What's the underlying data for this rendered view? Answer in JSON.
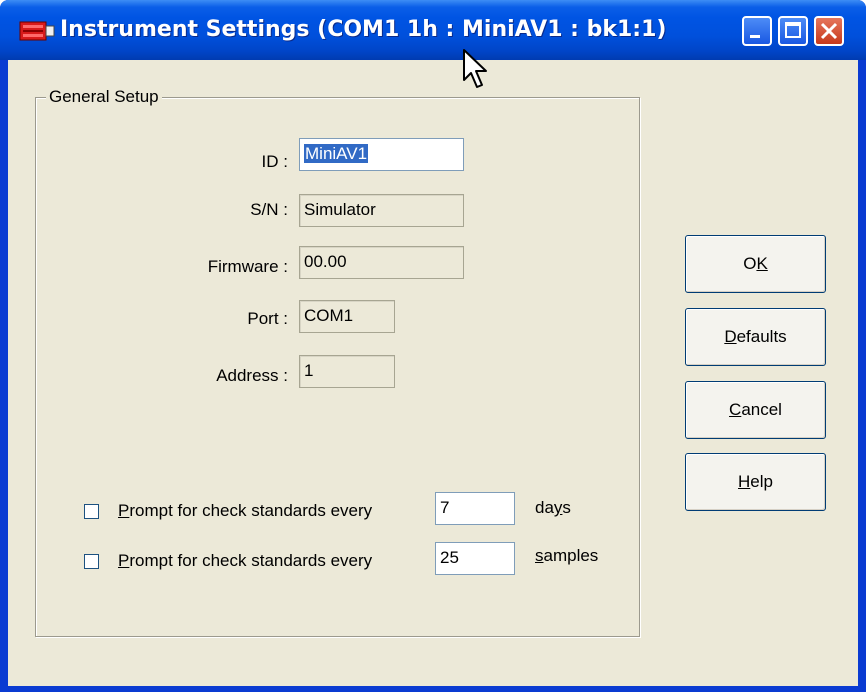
{
  "window": {
    "title": "Instrument Settings (COM1 1h : MiniAV1 : bk1:1)",
    "controls": [
      "minimize-icon",
      "maximize-icon",
      "close-icon"
    ]
  },
  "group": {
    "label": "General Setup"
  },
  "fields": {
    "id": {
      "label": "ID :",
      "value": "MiniAV1"
    },
    "sn": {
      "label": "S/N :",
      "value": "Simulator"
    },
    "firmware": {
      "label": "Firmware :",
      "value": "00.00"
    },
    "port": {
      "label": "Port :",
      "value": "COM1"
    },
    "address": {
      "label": "Address :",
      "value": "1"
    }
  },
  "prompts": [
    {
      "label_mnemonic": "P",
      "label_rest": "rompt for check standards every",
      "value": "7",
      "unit_pre": "da",
      "unit_mnemonic": "y",
      "unit_post": "s",
      "checked": false
    },
    {
      "label_mnemonic": "P",
      "label_rest": "rompt for check standards every",
      "value": "25",
      "unit_pre": "",
      "unit_mnemonic": "s",
      "unit_post": "amples",
      "checked": false
    }
  ],
  "buttons": {
    "ok": {
      "pre": "O",
      "mnemonic": "K",
      "post": ""
    },
    "defaults": {
      "pre": "",
      "mnemonic": "D",
      "post": "efaults"
    },
    "cancel": {
      "pre": "",
      "mnemonic": "C",
      "post": "ancel"
    },
    "help": {
      "pre": "",
      "mnemonic": "H",
      "post": "elp"
    }
  },
  "colors": {
    "titlebar": "#0054e3",
    "dialog_bg": "#ece9d8",
    "selection": "#316ac5",
    "close_button": "#c7391c"
  }
}
